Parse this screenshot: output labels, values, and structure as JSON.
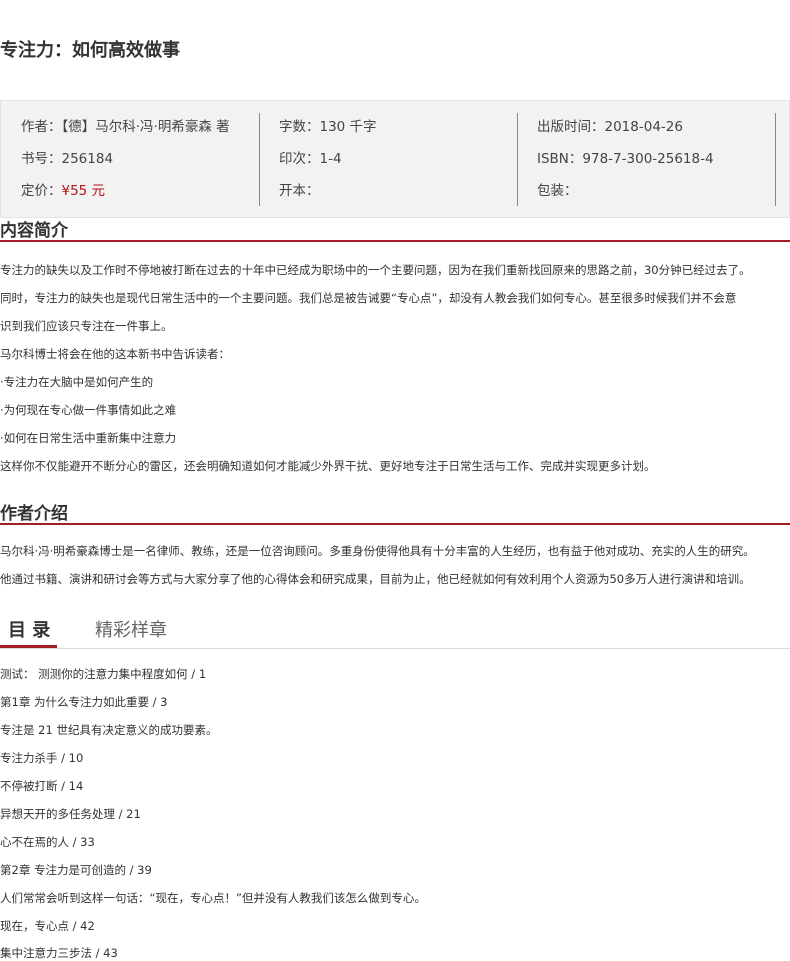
{
  "book": {
    "title": "专注力：如何高效做事"
  },
  "info": {
    "author": "作者：【德】马尔科·冯·明希豪森 著",
    "isbn_no": "书号：256184",
    "price_label": "定价：",
    "price_value": "¥55 元",
    "word_count": "字数：130 千字",
    "printing": "印次：1-4",
    "format": "开本：",
    "pub_date": "出版时间：2018-04-26",
    "isbn": "ISBN：978-7-300-25618-4",
    "binding": "包装："
  },
  "intro": {
    "heading": "内容简介",
    "lines": [
      "专注力的缺失以及工作时不停地被打断在过去的十年中已经成为职场中的一个主要问题，因为在我们重新找回原来的思路之前，30分钟已经过去了。",
      "同时，专注力的缺失也是现代日常生活中的一个主要问题。我们总是被告诫要“专心点”，却没有人教会我们如何专心。甚至很多时候我们并不会意",
      "识到我们应该只专注在一件事上。",
      "马尔科博士将会在他的这本新书中告诉读者：",
      "·专注力在大脑中是如何产生的",
      "·为何现在专心做一件事情如此之难",
      "·如何在日常生活中重新集中注意力",
      "这样你不仅能避开不断分心的雷区，还会明确知道如何才能减少外界干扰、更好地专注于日常生活与工作、完成并实现更多计划。"
    ]
  },
  "author_intro": {
    "heading": "作者介绍",
    "lines": [
      "马尔科·冯·明希豪森博士是一名律师、教练，还是一位咨询顾问。多重身份使得他具有十分丰富的人生经历，也有益于他对成功、充实的人生的研究。",
      "他通过书籍、演讲和研讨会等方式与大家分享了他的心得体会和研究成果，目前为止，他已经就如何有效利用个人资源为50多万人进行演讲和培训。"
    ]
  },
  "tabs": {
    "toc": "目 录",
    "sample": "精彩样章"
  },
  "toc": [
    "测试： 测测你的注意力集中程度如何 / 1",
    "第1章 为什么专注力如此重要 / 3",
    "专注是 21 世纪具有决定意义的成功要素。",
    "专注力杀手 / 10",
    "不停被打断 / 14",
    "异想天开的多任务处理 / 21",
    "心不在焉的人 / 33",
    "第2章 专注力是可创造的 / 39",
    "人们常常会听到这样一句话：“现在，专心点！”但并没有人教我们该怎么做到专心。",
    "现在，专心点 / 42",
    "集中注意力三步法 / 43"
  ]
}
